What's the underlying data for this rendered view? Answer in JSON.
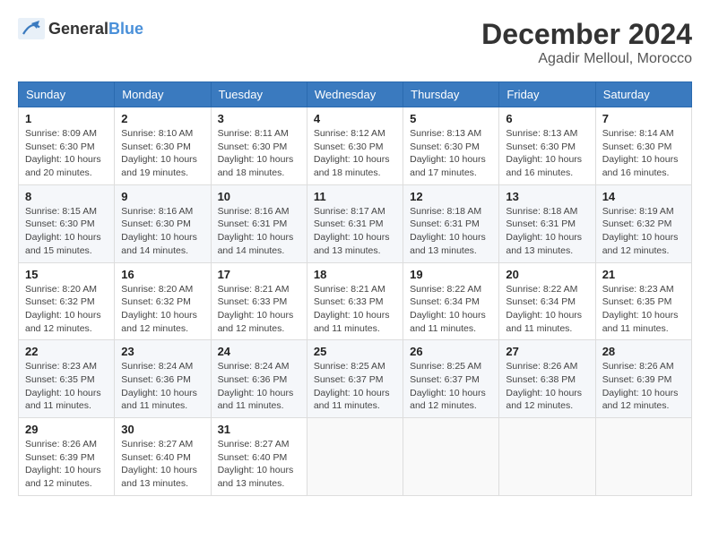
{
  "header": {
    "logo_general": "General",
    "logo_blue": "Blue",
    "month": "December 2024",
    "location": "Agadir Melloul, Morocco"
  },
  "weekdays": [
    "Sunday",
    "Monday",
    "Tuesday",
    "Wednesday",
    "Thursday",
    "Friday",
    "Saturday"
  ],
  "weeks": [
    [
      {
        "day": "1",
        "sunrise": "Sunrise: 8:09 AM",
        "sunset": "Sunset: 6:30 PM",
        "daylight": "Daylight: 10 hours and 20 minutes."
      },
      {
        "day": "2",
        "sunrise": "Sunrise: 8:10 AM",
        "sunset": "Sunset: 6:30 PM",
        "daylight": "Daylight: 10 hours and 19 minutes."
      },
      {
        "day": "3",
        "sunrise": "Sunrise: 8:11 AM",
        "sunset": "Sunset: 6:30 PM",
        "daylight": "Daylight: 10 hours and 18 minutes."
      },
      {
        "day": "4",
        "sunrise": "Sunrise: 8:12 AM",
        "sunset": "Sunset: 6:30 PM",
        "daylight": "Daylight: 10 hours and 18 minutes."
      },
      {
        "day": "5",
        "sunrise": "Sunrise: 8:13 AM",
        "sunset": "Sunset: 6:30 PM",
        "daylight": "Daylight: 10 hours and 17 minutes."
      },
      {
        "day": "6",
        "sunrise": "Sunrise: 8:13 AM",
        "sunset": "Sunset: 6:30 PM",
        "daylight": "Daylight: 10 hours and 16 minutes."
      },
      {
        "day": "7",
        "sunrise": "Sunrise: 8:14 AM",
        "sunset": "Sunset: 6:30 PM",
        "daylight": "Daylight: 10 hours and 16 minutes."
      }
    ],
    [
      {
        "day": "8",
        "sunrise": "Sunrise: 8:15 AM",
        "sunset": "Sunset: 6:30 PM",
        "daylight": "Daylight: 10 hours and 15 minutes."
      },
      {
        "day": "9",
        "sunrise": "Sunrise: 8:16 AM",
        "sunset": "Sunset: 6:30 PM",
        "daylight": "Daylight: 10 hours and 14 minutes."
      },
      {
        "day": "10",
        "sunrise": "Sunrise: 8:16 AM",
        "sunset": "Sunset: 6:31 PM",
        "daylight": "Daylight: 10 hours and 14 minutes."
      },
      {
        "day": "11",
        "sunrise": "Sunrise: 8:17 AM",
        "sunset": "Sunset: 6:31 PM",
        "daylight": "Daylight: 10 hours and 13 minutes."
      },
      {
        "day": "12",
        "sunrise": "Sunrise: 8:18 AM",
        "sunset": "Sunset: 6:31 PM",
        "daylight": "Daylight: 10 hours and 13 minutes."
      },
      {
        "day": "13",
        "sunrise": "Sunrise: 8:18 AM",
        "sunset": "Sunset: 6:31 PM",
        "daylight": "Daylight: 10 hours and 13 minutes."
      },
      {
        "day": "14",
        "sunrise": "Sunrise: 8:19 AM",
        "sunset": "Sunset: 6:32 PM",
        "daylight": "Daylight: 10 hours and 12 minutes."
      }
    ],
    [
      {
        "day": "15",
        "sunrise": "Sunrise: 8:20 AM",
        "sunset": "Sunset: 6:32 PM",
        "daylight": "Daylight: 10 hours and 12 minutes."
      },
      {
        "day": "16",
        "sunrise": "Sunrise: 8:20 AM",
        "sunset": "Sunset: 6:32 PM",
        "daylight": "Daylight: 10 hours and 12 minutes."
      },
      {
        "day": "17",
        "sunrise": "Sunrise: 8:21 AM",
        "sunset": "Sunset: 6:33 PM",
        "daylight": "Daylight: 10 hours and 12 minutes."
      },
      {
        "day": "18",
        "sunrise": "Sunrise: 8:21 AM",
        "sunset": "Sunset: 6:33 PM",
        "daylight": "Daylight: 10 hours and 11 minutes."
      },
      {
        "day": "19",
        "sunrise": "Sunrise: 8:22 AM",
        "sunset": "Sunset: 6:34 PM",
        "daylight": "Daylight: 10 hours and 11 minutes."
      },
      {
        "day": "20",
        "sunrise": "Sunrise: 8:22 AM",
        "sunset": "Sunset: 6:34 PM",
        "daylight": "Daylight: 10 hours and 11 minutes."
      },
      {
        "day": "21",
        "sunrise": "Sunrise: 8:23 AM",
        "sunset": "Sunset: 6:35 PM",
        "daylight": "Daylight: 10 hours and 11 minutes."
      }
    ],
    [
      {
        "day": "22",
        "sunrise": "Sunrise: 8:23 AM",
        "sunset": "Sunset: 6:35 PM",
        "daylight": "Daylight: 10 hours and 11 minutes."
      },
      {
        "day": "23",
        "sunrise": "Sunrise: 8:24 AM",
        "sunset": "Sunset: 6:36 PM",
        "daylight": "Daylight: 10 hours and 11 minutes."
      },
      {
        "day": "24",
        "sunrise": "Sunrise: 8:24 AM",
        "sunset": "Sunset: 6:36 PM",
        "daylight": "Daylight: 10 hours and 11 minutes."
      },
      {
        "day": "25",
        "sunrise": "Sunrise: 8:25 AM",
        "sunset": "Sunset: 6:37 PM",
        "daylight": "Daylight: 10 hours and 11 minutes."
      },
      {
        "day": "26",
        "sunrise": "Sunrise: 8:25 AM",
        "sunset": "Sunset: 6:37 PM",
        "daylight": "Daylight: 10 hours and 12 minutes."
      },
      {
        "day": "27",
        "sunrise": "Sunrise: 8:26 AM",
        "sunset": "Sunset: 6:38 PM",
        "daylight": "Daylight: 10 hours and 12 minutes."
      },
      {
        "day": "28",
        "sunrise": "Sunrise: 8:26 AM",
        "sunset": "Sunset: 6:39 PM",
        "daylight": "Daylight: 10 hours and 12 minutes."
      }
    ],
    [
      {
        "day": "29",
        "sunrise": "Sunrise: 8:26 AM",
        "sunset": "Sunset: 6:39 PM",
        "daylight": "Daylight: 10 hours and 12 minutes."
      },
      {
        "day": "30",
        "sunrise": "Sunrise: 8:27 AM",
        "sunset": "Sunset: 6:40 PM",
        "daylight": "Daylight: 10 hours and 13 minutes."
      },
      {
        "day": "31",
        "sunrise": "Sunrise: 8:27 AM",
        "sunset": "Sunset: 6:40 PM",
        "daylight": "Daylight: 10 hours and 13 minutes."
      },
      null,
      null,
      null,
      null
    ]
  ]
}
